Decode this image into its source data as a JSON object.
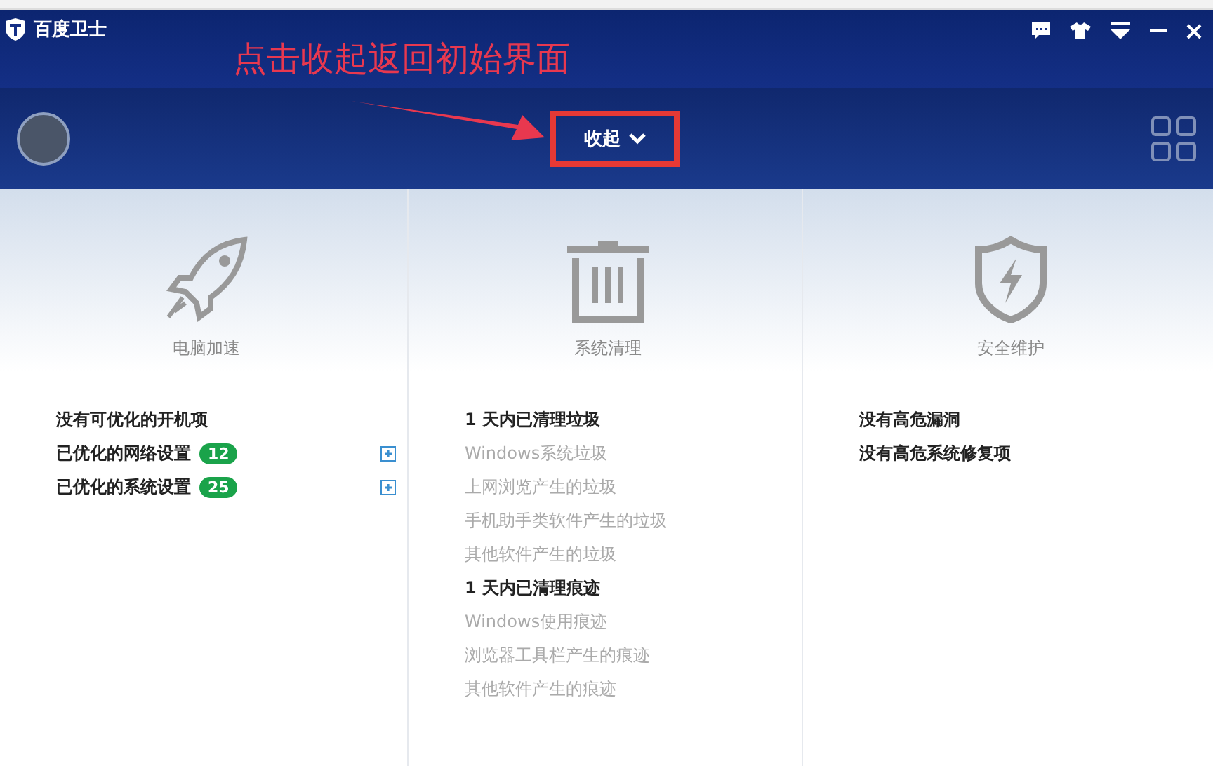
{
  "window": {
    "title": "百度卫士"
  },
  "annotation": {
    "text": "点击收起返回初始界面"
  },
  "header": {
    "collapse_button": {
      "label": "收起"
    }
  },
  "columns": [
    {
      "kind": "rocket",
      "title": "电脑加速",
      "items": [
        {
          "text": "没有可优化的开机项",
          "kind": "heading"
        },
        {
          "text": "已优化的网络设置",
          "kind": "heading",
          "badge": "12",
          "expandable": true
        },
        {
          "text": "已优化的系统设置",
          "kind": "heading",
          "badge": "25",
          "expandable": true
        }
      ]
    },
    {
      "kind": "trash",
      "title": "系统清理",
      "items": [
        {
          "text": "1 天内已清理垃圾",
          "kind": "heading"
        },
        {
          "text": "Windows系统垃圾",
          "kind": "entry"
        },
        {
          "text": "上网浏览产生的垃圾",
          "kind": "entry"
        },
        {
          "text": "手机助手类软件产生的垃圾",
          "kind": "entry"
        },
        {
          "text": "其他软件产生的垃圾",
          "kind": "entry"
        },
        {
          "text": "1 天内已清理痕迹",
          "kind": "heading"
        },
        {
          "text": "Windows使用痕迹",
          "kind": "entry"
        },
        {
          "text": "浏览器工具栏产生的痕迹",
          "kind": "entry"
        },
        {
          "text": "其他软件产生的痕迹",
          "kind": "entry"
        }
      ]
    },
    {
      "kind": "shield",
      "title": "安全维护",
      "items": [
        {
          "text": "没有高危漏洞",
          "kind": "heading"
        },
        {
          "text": "没有高危系统修复项",
          "kind": "heading"
        }
      ]
    }
  ]
}
